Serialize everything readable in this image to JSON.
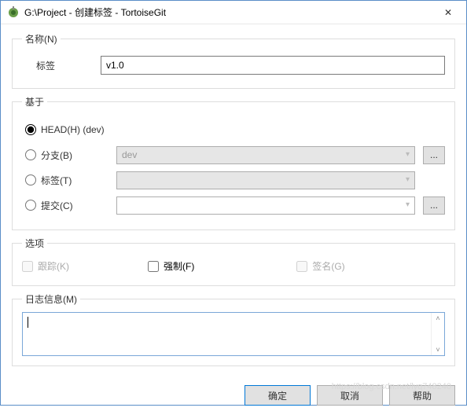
{
  "window": {
    "title": "G:\\Project - 创建标签 - TortoiseGit",
    "close_glyph": "✕"
  },
  "name_group": {
    "legend": "名称(N)",
    "tag_label": "标签",
    "tag_value": "v1.0"
  },
  "base_group": {
    "legend": "基于",
    "head_label": "HEAD(H) (dev)",
    "branch_label": "分支(B)",
    "branch_value": "dev",
    "tag_label": "标签(T)",
    "commit_label": "提交(C)",
    "commit_value": "",
    "dots": "..."
  },
  "options_group": {
    "legend": "选项",
    "track_label": "跟踪(K)",
    "force_label": "强制(F)",
    "sign_label": "签名(G)"
  },
  "log_group": {
    "legend": "日志信息(M)",
    "value": ""
  },
  "footer": {
    "ok": "确定",
    "cancel": "取消",
    "help": "帮助"
  },
  "watermark": "https://blog.csdn.net/lyq748240"
}
